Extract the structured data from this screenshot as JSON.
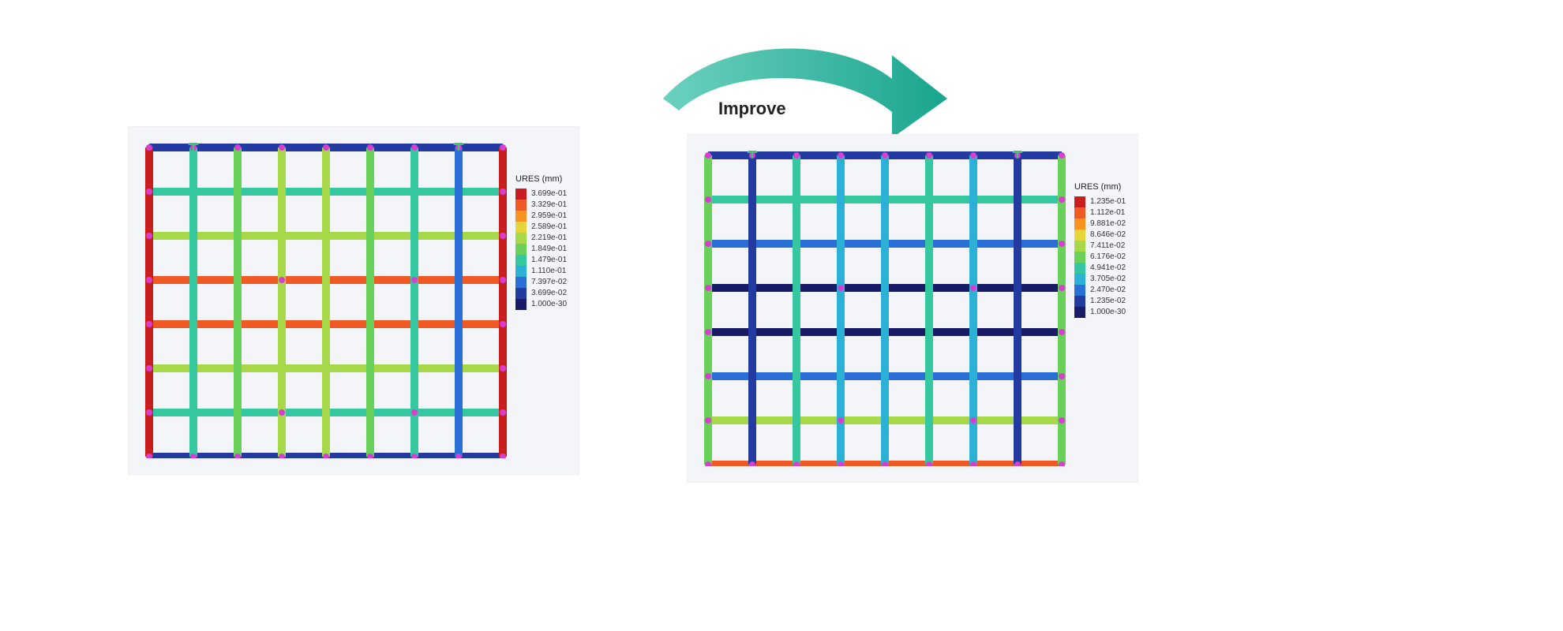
{
  "arrow": {
    "label": "Improve",
    "color": "#34b6a2"
  },
  "grid": {
    "cols": 8,
    "rows": 7,
    "cell": 56
  },
  "panels": {
    "left": {
      "legend_title": "URES (mm)",
      "legend": [
        {
          "label": "3.699e-01",
          "color": "#c81e1e"
        },
        {
          "label": "3.329e-01",
          "color": "#ef5a24"
        },
        {
          "label": "2.959e-01",
          "color": "#f7931e"
        },
        {
          "label": "2.589e-01",
          "color": "#e4d63a"
        },
        {
          "label": "2.219e-01",
          "color": "#a6d84a"
        },
        {
          "label": "1.849e-01",
          "color": "#69d05a"
        },
        {
          "label": "1.479e-01",
          "color": "#34c7a0"
        },
        {
          "label": "1.110e-01",
          "color": "#2bb0d6"
        },
        {
          "label": "7.397e-02",
          "color": "#2a6fd6"
        },
        {
          "label": "3.699e-02",
          "color": "#233aa0"
        },
        {
          "label": "1.000e-30",
          "color": "#181c66"
        }
      ],
      "h_colors": [
        "#233aa0",
        "#34c7a0",
        "#a6d84a",
        "#ef5a24",
        "#ef5a24",
        "#a6d84a",
        "#34c7a0",
        "#233aa0"
      ],
      "v_colors": [
        "#233aa0",
        "#34c7a0",
        "#69d05a",
        "#a6d84a",
        "#a6d84a",
        "#69d05a",
        "#34c7a0",
        "#2a6fd6",
        "#233aa0"
      ],
      "edge_color_left": "#c81e1e",
      "edge_color_right": "#c81e1e"
    },
    "right": {
      "legend_title": "URES (mm)",
      "legend": [
        {
          "label": "1.235e-01",
          "color": "#c81e1e"
        },
        {
          "label": "1.112e-01",
          "color": "#ef5a24"
        },
        {
          "label": "9.881e-02",
          "color": "#f7931e"
        },
        {
          "label": "8.646e-02",
          "color": "#e4d63a"
        },
        {
          "label": "7.411e-02",
          "color": "#a6d84a"
        },
        {
          "label": "6.176e-02",
          "color": "#69d05a"
        },
        {
          "label": "4.941e-02",
          "color": "#34c7a0"
        },
        {
          "label": "3.705e-02",
          "color": "#2bb0d6"
        },
        {
          "label": "2.470e-02",
          "color": "#2a6fd6"
        },
        {
          "label": "1.235e-02",
          "color": "#233aa0"
        },
        {
          "label": "1.000e-30",
          "color": "#181c66"
        }
      ],
      "h_colors": [
        "#233aa0",
        "#34c7a0",
        "#2a6fd6",
        "#181c66",
        "#181c66",
        "#2a6fd6",
        "#a6d84a",
        "#ef5a24"
      ],
      "v_colors": [
        "#69d05a",
        "#233aa0",
        "#34c7a0",
        "#2bb0d6",
        "#2bb0d6",
        "#34c7a0",
        "#2bb0d6",
        "#233aa0",
        "#69d05a"
      ],
      "edge_color_left": "#69d05a",
      "edge_color_right": "#69d05a"
    }
  },
  "markers": {
    "anchor_color": "#3cc96b",
    "node_color": "#d63fd0"
  }
}
